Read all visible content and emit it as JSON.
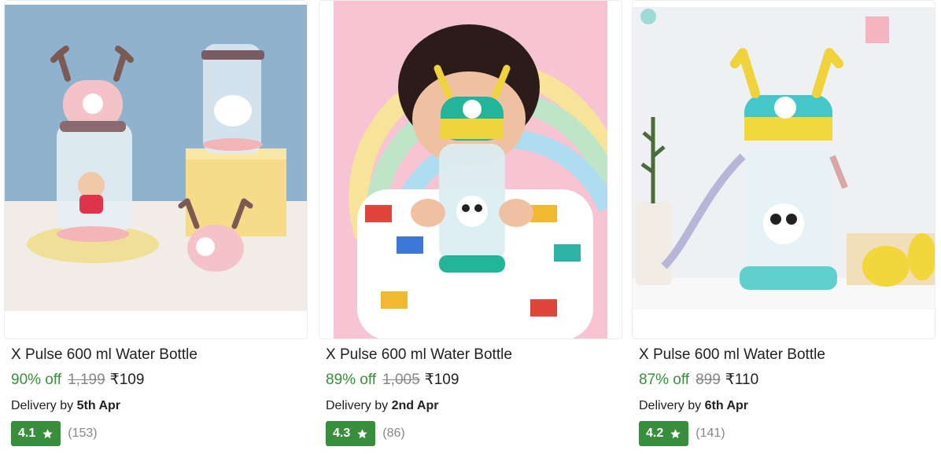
{
  "products": [
    {
      "title": "X Pulse 600 ml Water Bottle",
      "discount": "90% off",
      "mrp": "1,199",
      "price": "₹109",
      "delivery_prefix": "Delivery by",
      "delivery_date": "5th Apr",
      "rating": "4.1",
      "rating_count": "(153)",
      "image_icon": "deer-bottle-product-photo"
    },
    {
      "title": "X Pulse 600 ml Water Bottle",
      "discount": "89% off",
      "mrp": "1,005",
      "price": "₹109",
      "delivery_prefix": "Delivery by",
      "delivery_date": "2nd Apr",
      "rating": "4.3",
      "rating_count": "(86)",
      "image_icon": "child-holding-panda-bottle-photo"
    },
    {
      "title": "X Pulse 600 ml Water Bottle",
      "discount": "87% off",
      "mrp": "899",
      "price": "₹110",
      "delivery_prefix": "Delivery by",
      "delivery_date": "6th Apr",
      "rating": "4.2",
      "rating_count": "(141)",
      "image_icon": "panda-bottle-yellow-lid-photo"
    }
  ],
  "colors": {
    "discount_green": "#388e3c",
    "rating_badge": "#388e3c",
    "muted_gray": "#878787"
  }
}
